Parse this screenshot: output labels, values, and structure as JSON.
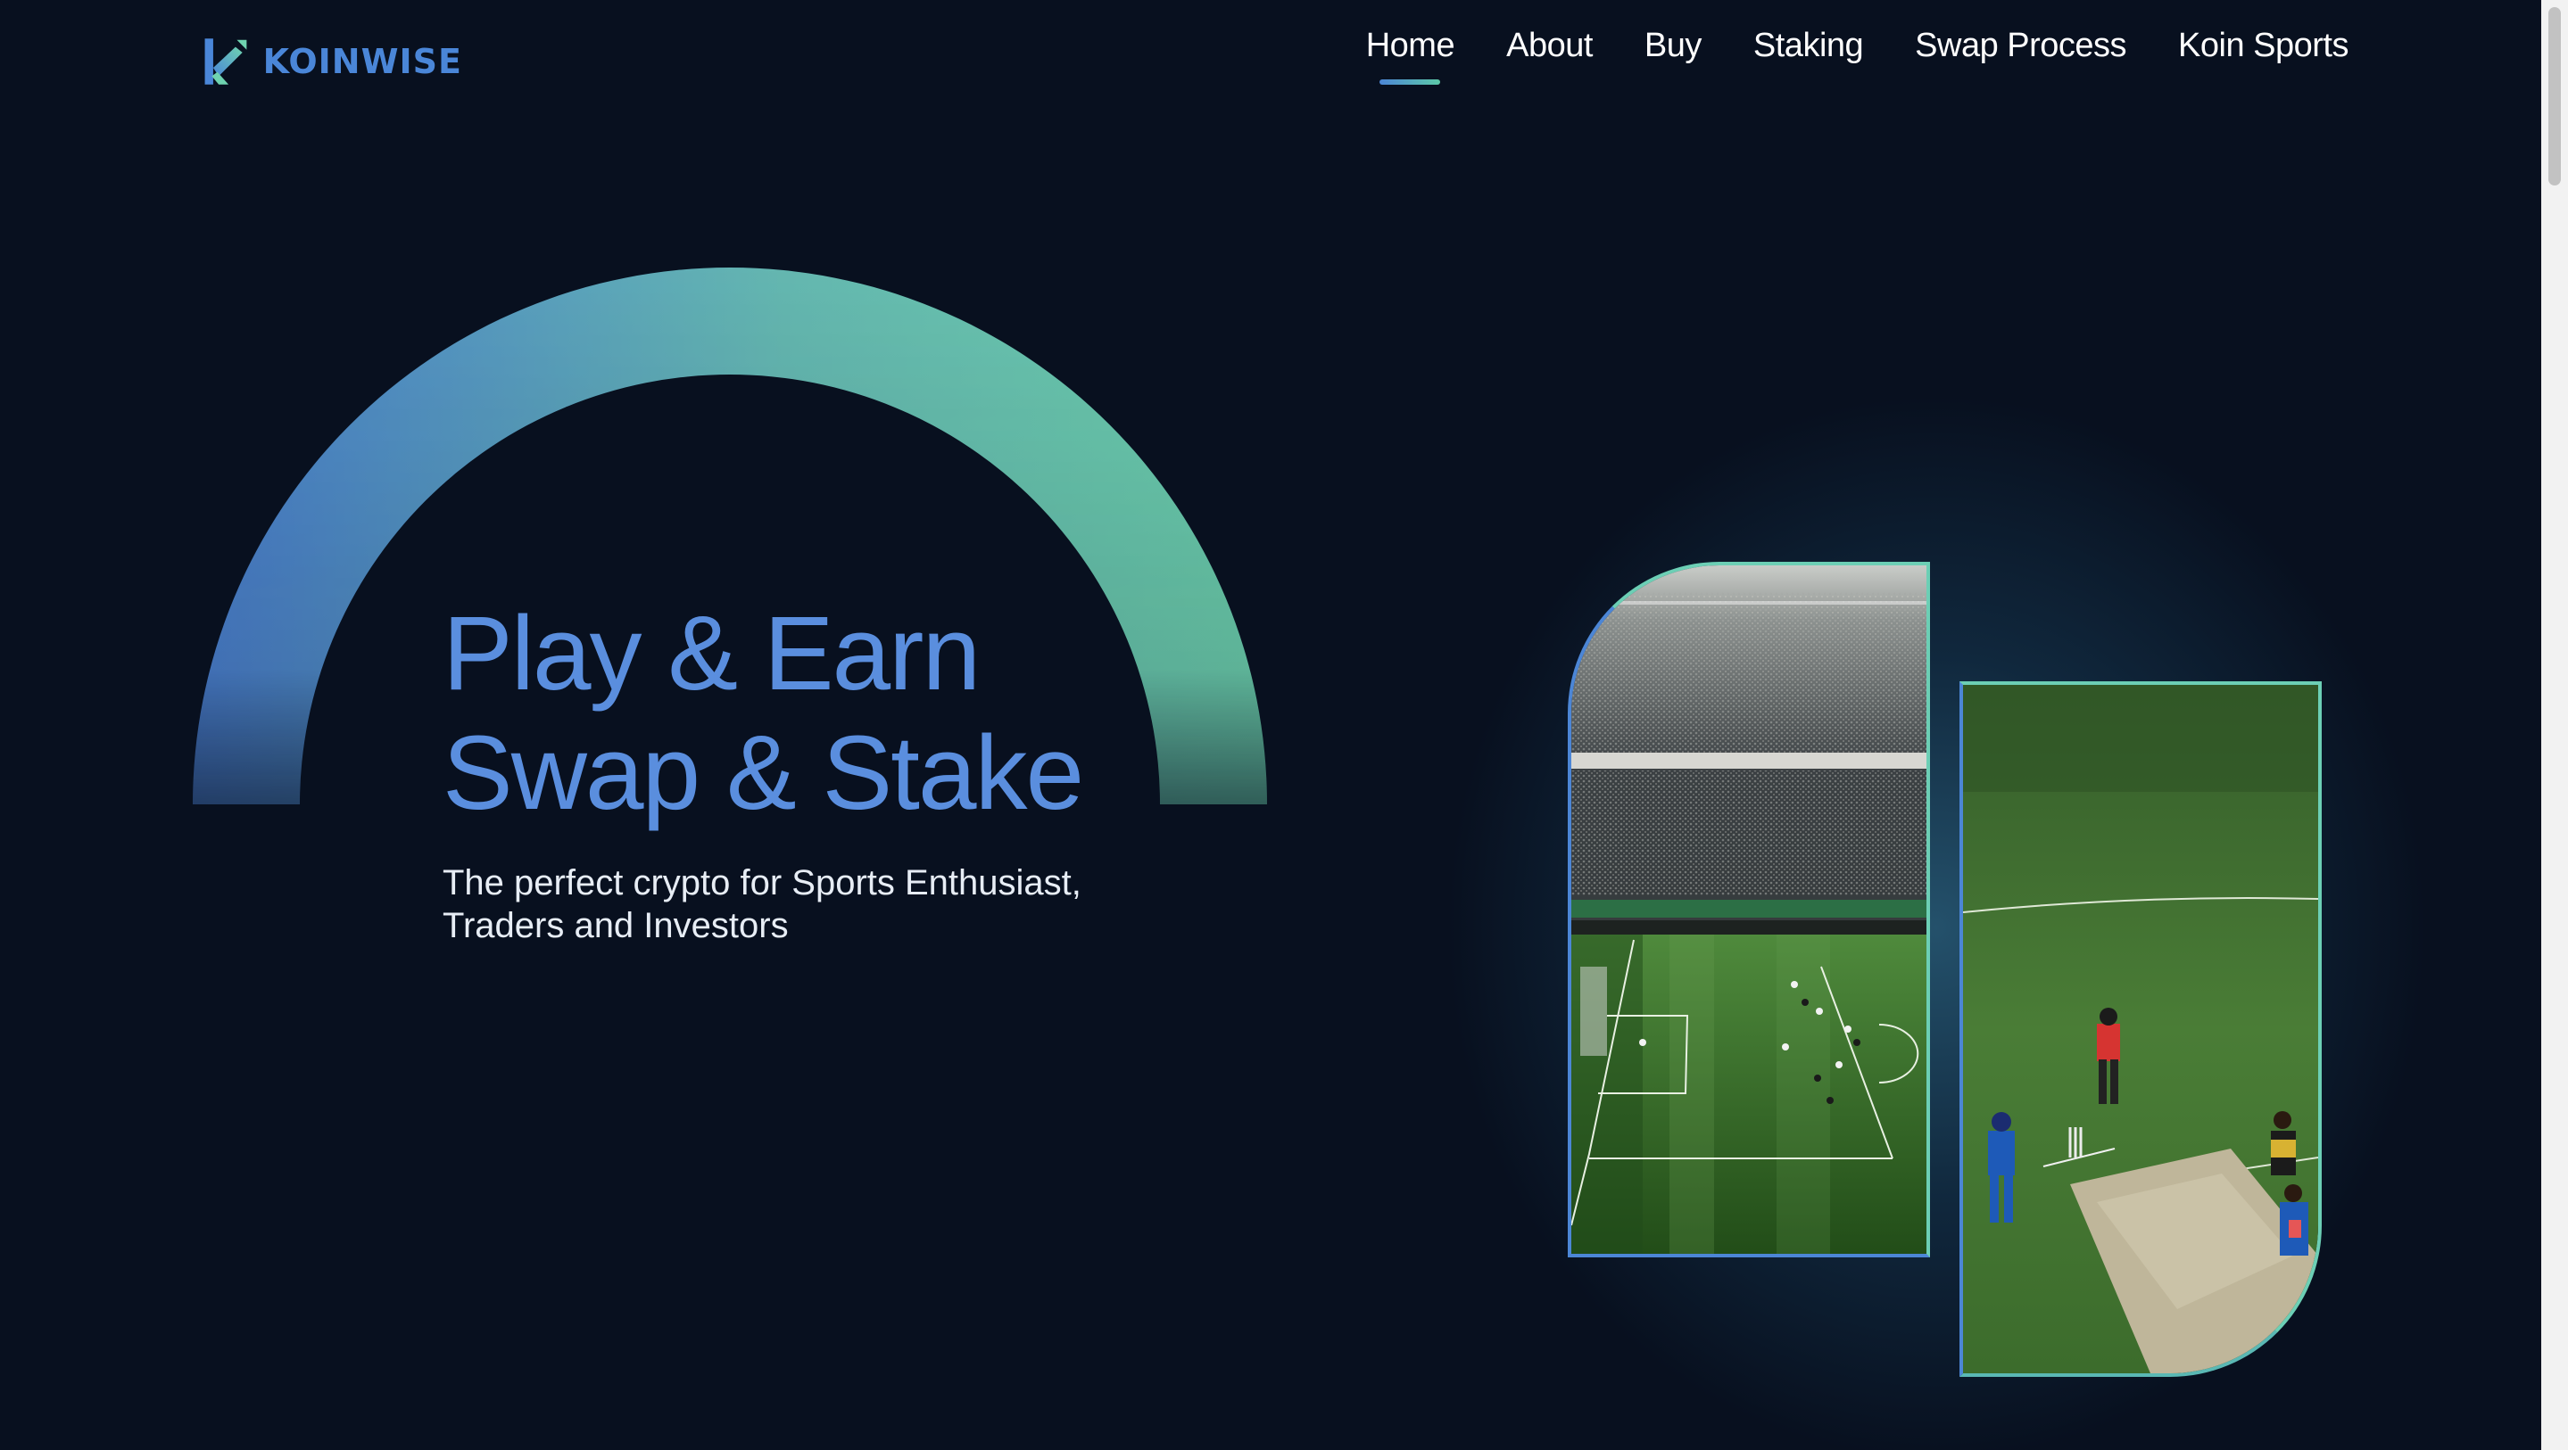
{
  "header": {
    "logo_text": "KOINWISE",
    "logo_icon": "koinwise-k-logo-icon",
    "nav": [
      {
        "label": "Home",
        "active": true
      },
      {
        "label": "About",
        "active": false
      },
      {
        "label": "Buy",
        "active": false
      },
      {
        "label": "Staking",
        "active": false
      },
      {
        "label": "Swap Process",
        "active": false
      },
      {
        "label": "Koin Sports",
        "active": false
      }
    ]
  },
  "hero": {
    "headline_line1": "Play & Earn",
    "headline_line2": "Swap & Stake",
    "subtitle": "The perfect crypto for Sports Enthusiast, Traders and Investors",
    "images": [
      "football-stadium-image",
      "cricket-match-image"
    ]
  },
  "colors": {
    "background": "#08101f",
    "accent_blue": "#4c86d6",
    "accent_teal": "#5cc9a8",
    "headline": "#5a8ede"
  }
}
